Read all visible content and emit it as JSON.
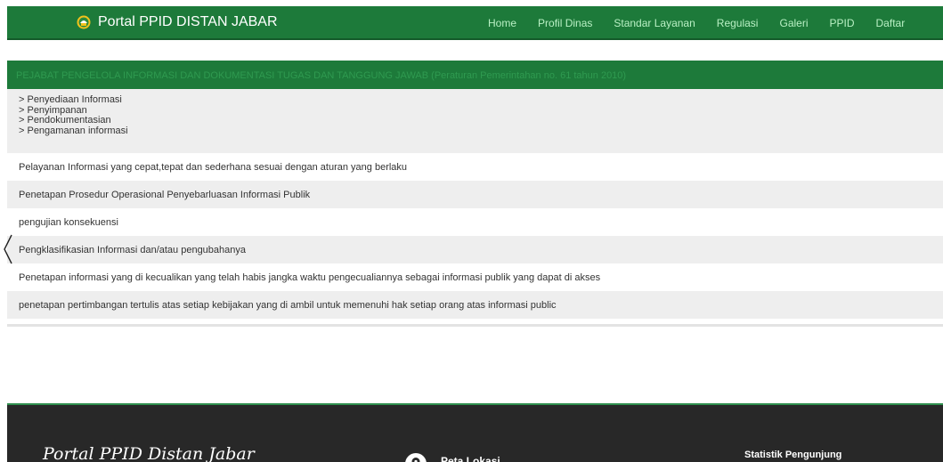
{
  "colors": {
    "brand_green": "#1d7a3a",
    "row_grey": "#eeeeee",
    "footer_bg": "#282828"
  },
  "navbar": {
    "brand": "Portal PPID DISTAN JABAR",
    "logo_icon": "seal-logo-icon",
    "menu": [
      "Home",
      "Profil Dinas",
      "Standar Layanan",
      "Regulasi",
      "Galeri",
      "PPID",
      "Daftar"
    ]
  },
  "content": {
    "header": "PEJABAT PENGELOLA INFORMASI DAN DOKUMENTASI TUGAS DAN TANGGUNG JAWAB (Peraturan Pemerintahan no. 61 tahun 2010)",
    "list_items": [
      "> Penyediaan Informasi",
      "> Penyimpanan",
      "> Pendokumentasian",
      "> Pengamanan informasi"
    ],
    "rows": [
      "Pelayanan Informasi yang cepat,tepat dan sederhana sesuai dengan aturan yang berlaku",
      "Penetapan Prosedur Operasional Penyebarluasan Informasi Publik",
      "pengujian konsekuensi",
      "Pengklasifikasian Informasi dan/atau pengubahanya",
      "Penetapan informasi yang di kecualikan yang telah habis jangka waktu pengecualiannya sebagai informasi publik yang dapat di akses",
      "penetapan pertimbangan tertulis atas setiap kebijakan yang di ambil untuk memenuhi hak setiap orang atas informasi public"
    ]
  },
  "footer": {
    "brand": "Portal PPID Distan Jabar",
    "location_label": "Peta Lokasi",
    "stats_label": "Statistik Pengunjung"
  }
}
